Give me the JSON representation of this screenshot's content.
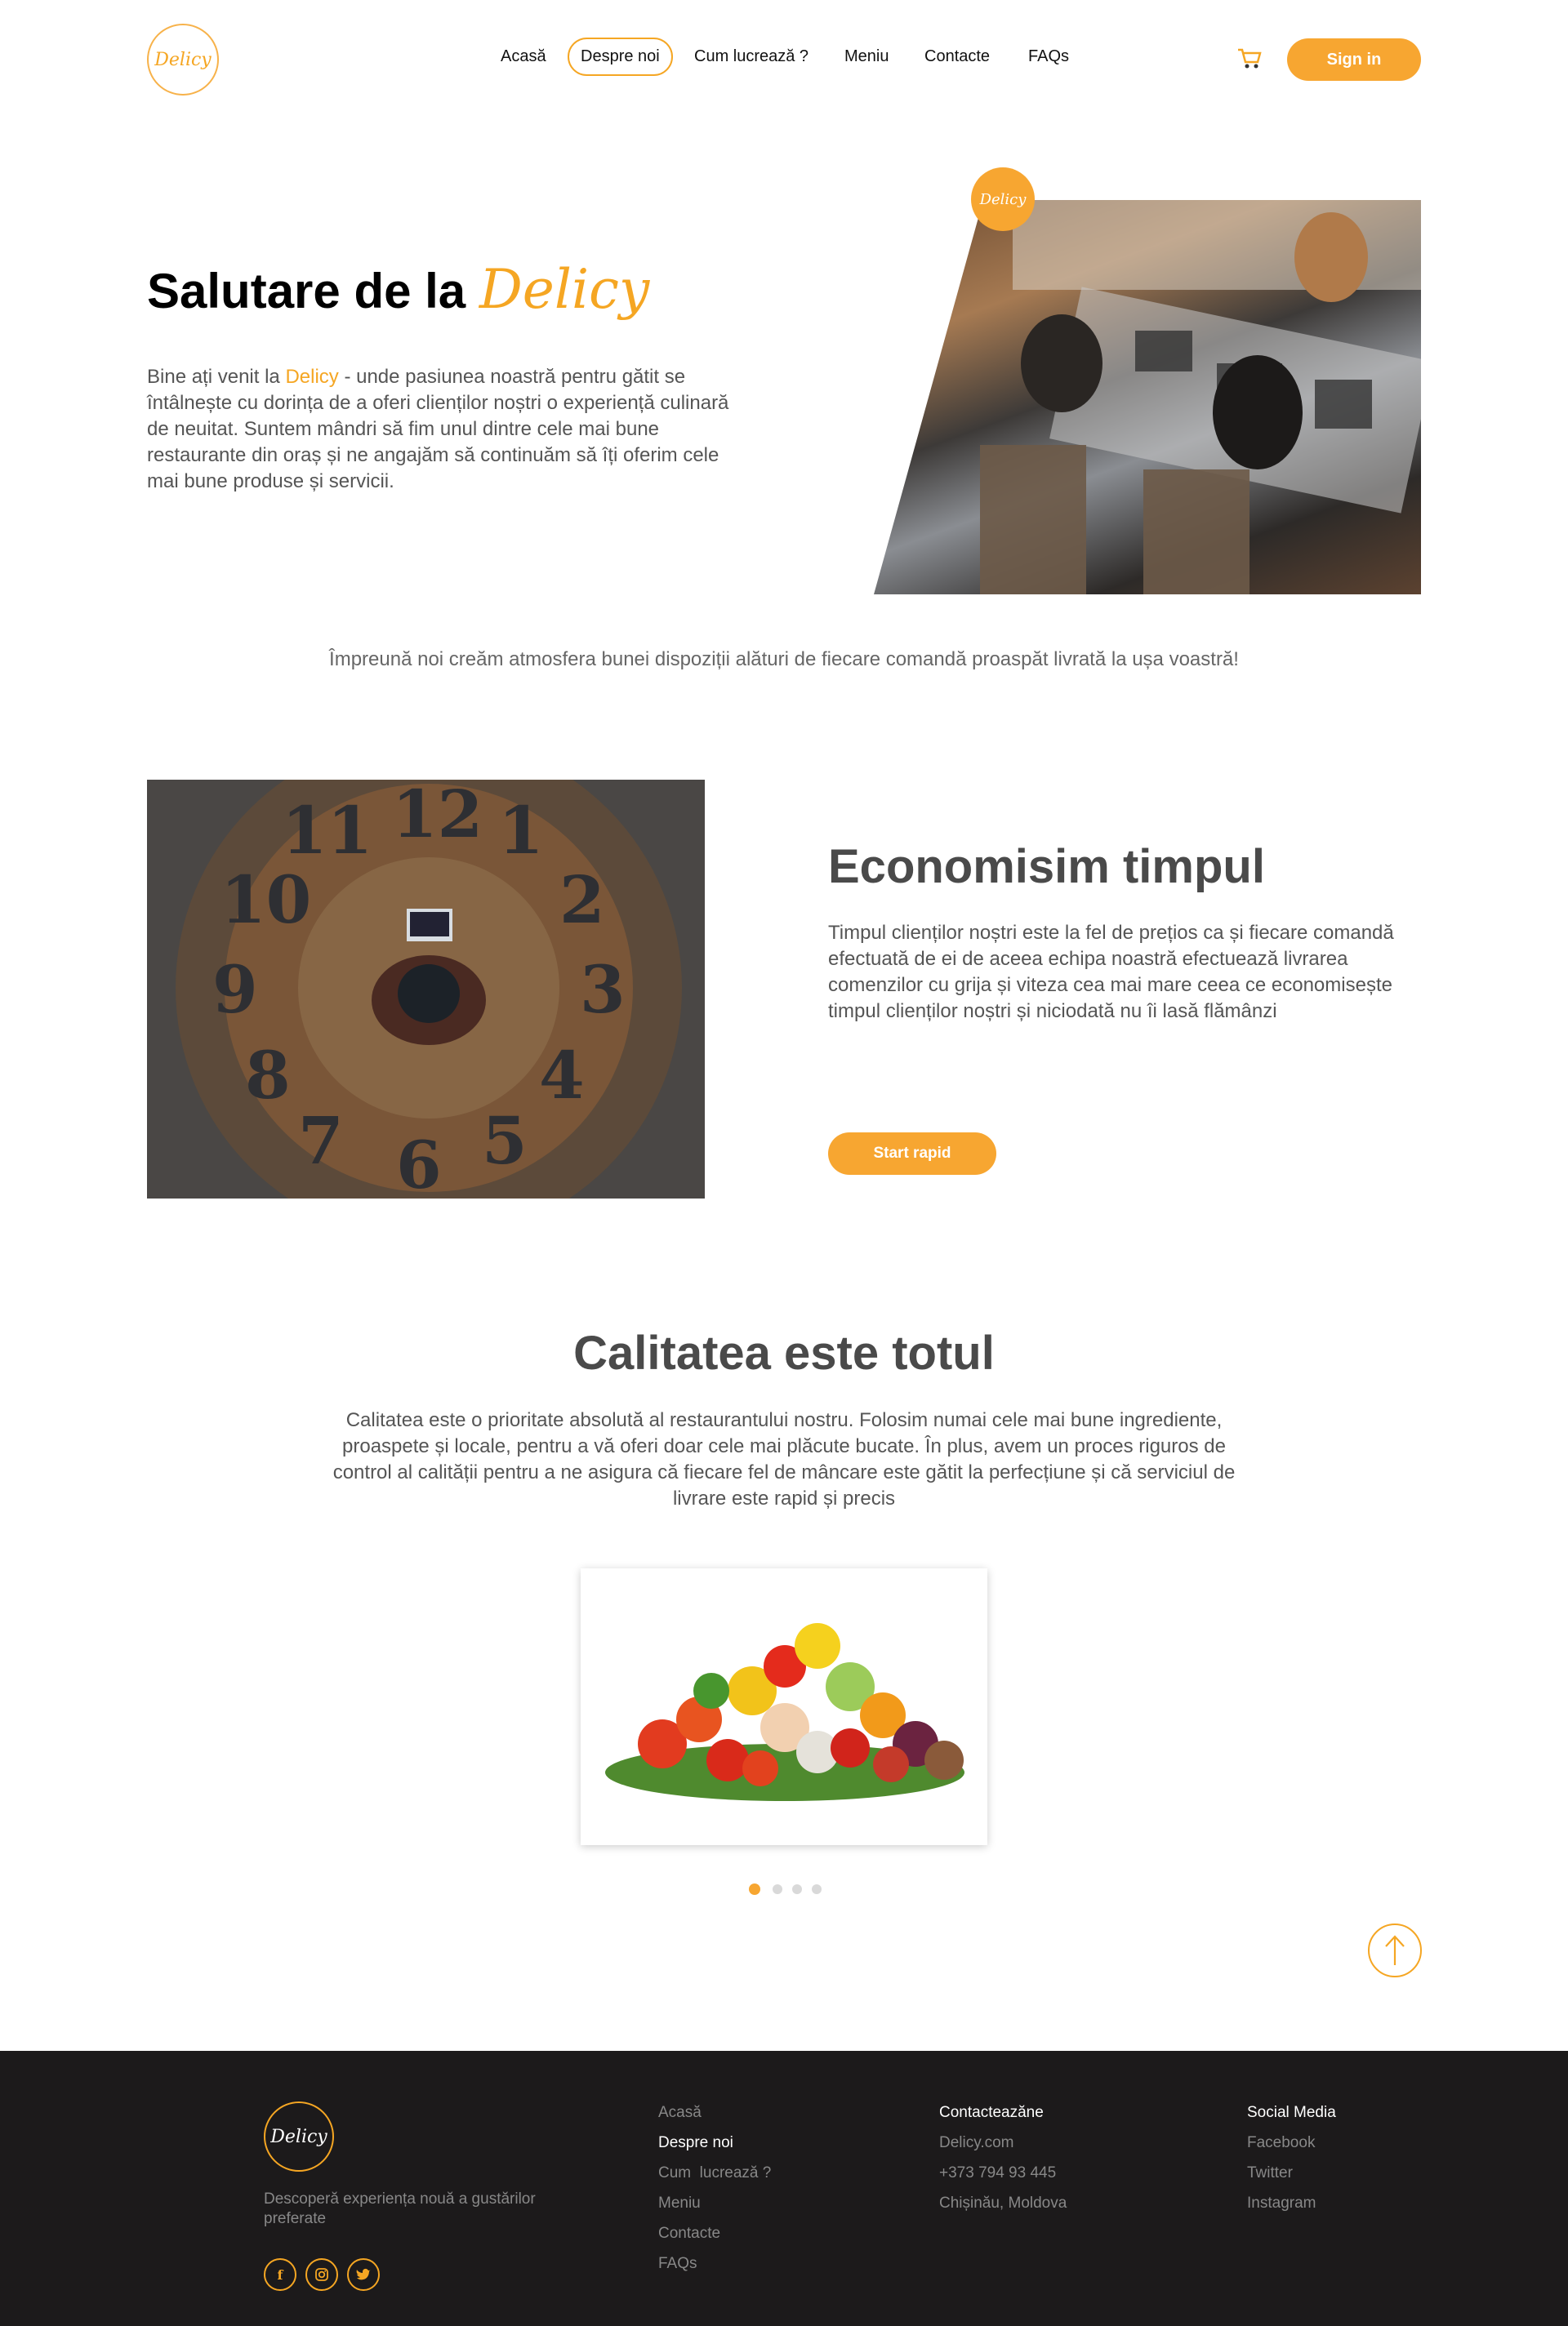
{
  "brand": {
    "name": "Delicy"
  },
  "nav": {
    "items": [
      "Acasă",
      "Despre noi",
      "Cum lucrează ?",
      "Meniu",
      "Contacte",
      "FAQs"
    ],
    "active": "Despre noi",
    "signin_label": "Sign in"
  },
  "hero": {
    "title_prefix": "Salutare de la",
    "title_brand": "Delicy",
    "intro_prefix": "Bine ați venit la ",
    "intro_brand": "Delicy",
    "intro_rest": " - unde pasiunea noastră pentru gătit se întâlnește cu dorința de a oferi clienților noștri o experiență culinară de neuitat. Suntem mândri să fim unul dintre cele mai bune restaurante din oraș și ne angajăm să continuăm să îți oferim cele mai bune produse și servicii."
  },
  "tagline": "Împreună noi creăm atmosfera bunei dispoziții alături de fiecare comandă proaspăt livrată la ușa voastră!",
  "time_section": {
    "title": "Economisim timpul",
    "text": "Timpul clienților noștri este la fel de prețios ca și fiecare comandă efectuată de ei de aceea echipa noastră efectuează livrarea comenzilor cu grija și viteza cea mai mare ceea ce economisește timpul clienților noștri și niciodată nu îi lasă flămânzi",
    "button_label": "Start rapid"
  },
  "quality_section": {
    "title": "Calitatea este totul",
    "text": "Calitatea este o prioritate absolută al restaurantului nostru. Folosim numai cele mai bune ingrediente, proaspete și locale, pentru a vă oferi doar cele mai plăcute bucate. În plus, avem un proces riguros de control al calității pentru a ne asigura că fiecare fel de mâncare este gătit la perfecțiune și că serviciul de livrare este rapid și precis",
    "carousel": {
      "slide_count": 4,
      "active_index": 0
    }
  },
  "footer": {
    "tagline": "Descoperă experiența nouă a gustărilor preferate",
    "links": [
      "Acasă",
      "Despre noi",
      "Cum  lucrează ?",
      "Meniu",
      "Contacte",
      "FAQs"
    ],
    "active_link": "Despre noi",
    "contact": {
      "heading": "Contacteazăne",
      "website": "Delicy.com",
      "phone": "+373 794 93 445",
      "address": "Chișinău, Moldova"
    },
    "social": {
      "heading": "Social Media",
      "items": [
        "Facebook",
        "Twitter",
        "Instagram"
      ]
    },
    "social_icons": [
      "facebook-icon",
      "instagram-icon",
      "twitter-icon"
    ]
  },
  "colors": {
    "accent": "#f7a631",
    "footer_bg": "#1c1a1b",
    "text": "#555555"
  }
}
